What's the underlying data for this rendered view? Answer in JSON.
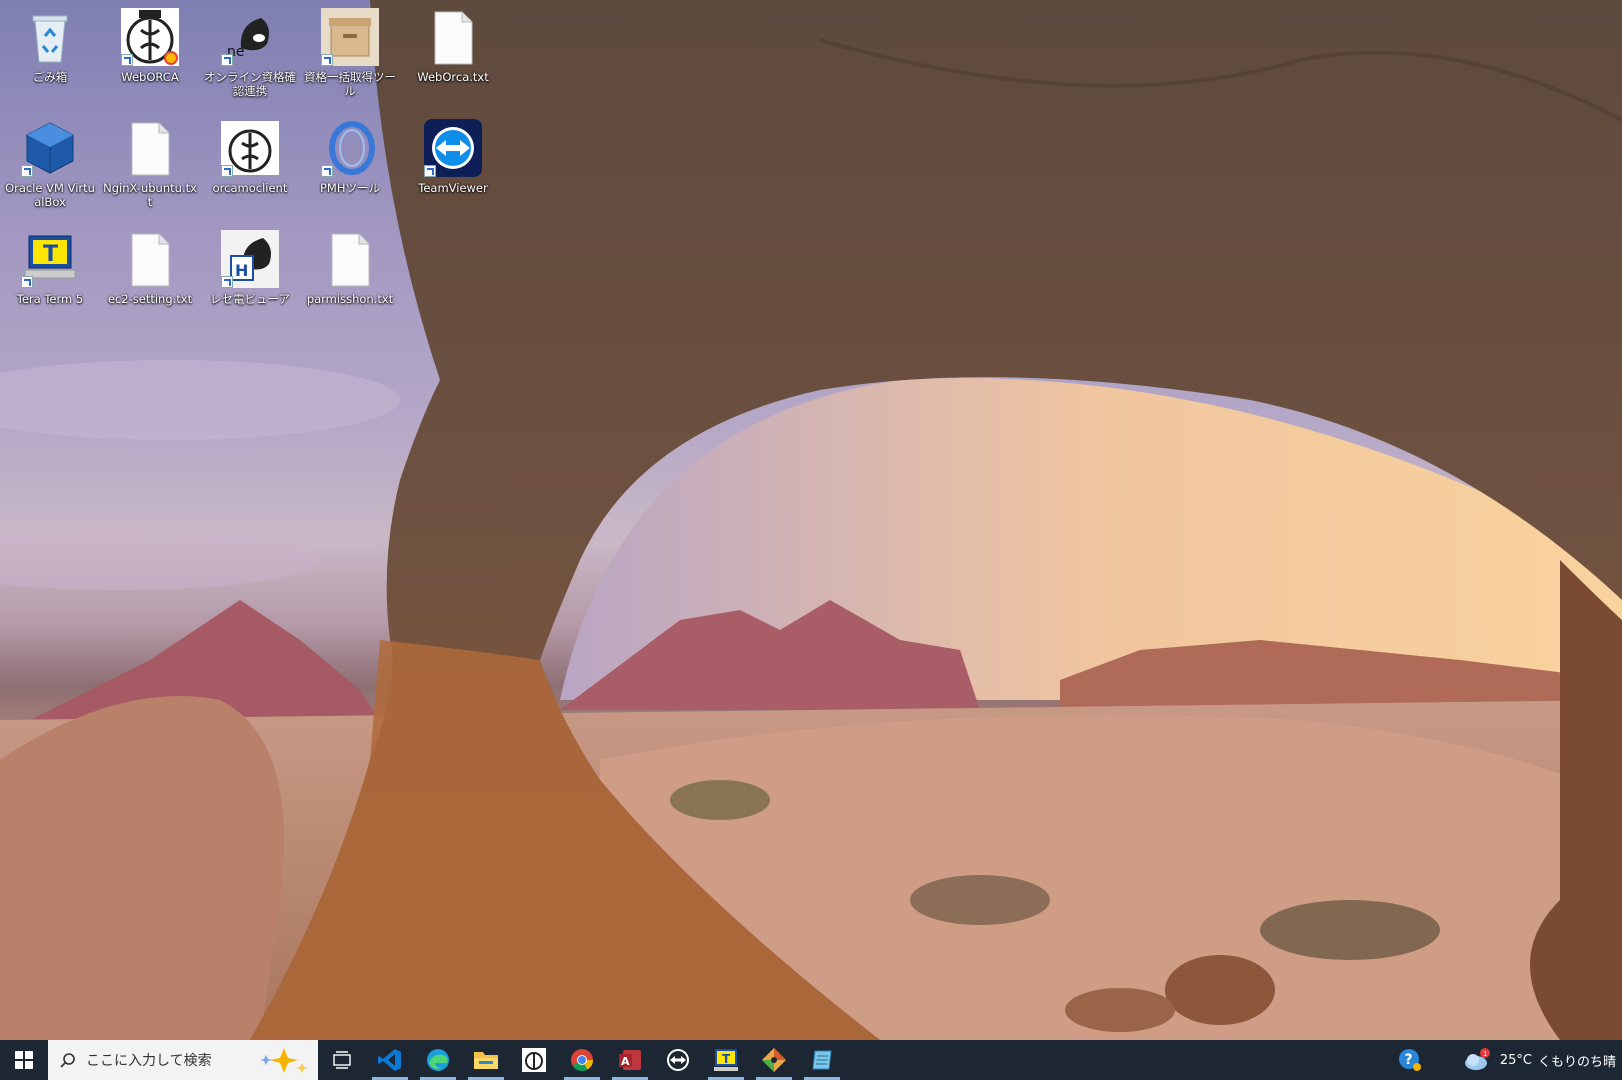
{
  "desktop": {
    "icons": [
      {
        "label": "ごみ箱",
        "icon": "recycle-bin-icon"
      },
      {
        "label": "WebORCA",
        "icon": "orca-icon"
      },
      {
        "label": "オンライン資格確認連携",
        "icon": "orca-online-icon"
      },
      {
        "label": "資格一括取得ツール",
        "icon": "archive-box-icon"
      },
      {
        "label": "WebOrca.txt",
        "icon": "text-file-icon"
      },
      {
        "label": "Oracle VM VirtualBox",
        "icon": "virtualbox-icon"
      },
      {
        "label": "NginX-ubuntu.txt",
        "icon": "text-file-icon"
      },
      {
        "label": "orcamoclient",
        "icon": "orca-icon"
      },
      {
        "label": "PMHツール",
        "icon": "pmh-icon"
      },
      {
        "label": "TeamViewer",
        "icon": "teamviewer-icon"
      },
      {
        "label": "Tera Term 5",
        "icon": "teraterm-icon"
      },
      {
        "label": "ec2-setting.txt",
        "icon": "text-file-icon"
      },
      {
        "label": "レセ電ビューア",
        "icon": "rece-viewer-icon"
      },
      {
        "label": "parmisshon.txt",
        "icon": "text-file-icon"
      }
    ]
  },
  "taskbar": {
    "search_placeholder": "ここに入力して検索",
    "apps": [
      "task-view-icon",
      "vscode-icon",
      "edge-icon",
      "file-explorer-icon",
      "orca-icon",
      "chrome-icon",
      "access-icon",
      "teamviewer-icon",
      "teraterm-icon",
      "git-icon",
      "notepad-icon"
    ],
    "weather": {
      "temp": "25°C",
      "condition": "くもりのち晴",
      "badge": "1"
    }
  }
}
